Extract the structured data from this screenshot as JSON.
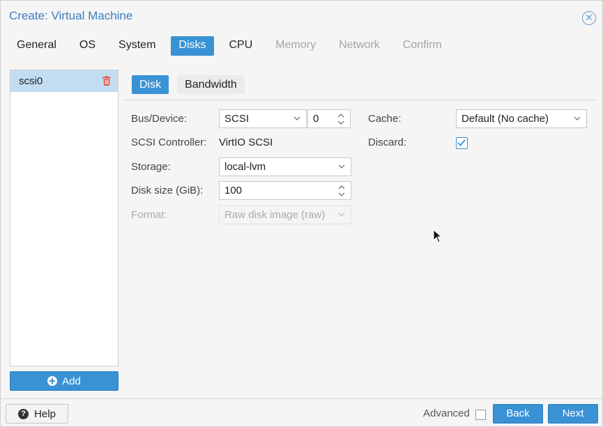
{
  "window": {
    "title": "Create: Virtual Machine"
  },
  "tabs": [
    {
      "label": "General",
      "state": "normal"
    },
    {
      "label": "OS",
      "state": "normal"
    },
    {
      "label": "System",
      "state": "normal"
    },
    {
      "label": "Disks",
      "state": "active"
    },
    {
      "label": "CPU",
      "state": "normal"
    },
    {
      "label": "Memory",
      "state": "disabled"
    },
    {
      "label": "Network",
      "state": "disabled"
    },
    {
      "label": "Confirm",
      "state": "disabled"
    }
  ],
  "disks": {
    "items": [
      {
        "label": "scsi0"
      }
    ],
    "add_label": "Add"
  },
  "subtabs": [
    {
      "label": "Disk"
    },
    {
      "label": "Bandwidth"
    }
  ],
  "form": {
    "bus_device_label": "Bus/Device:",
    "bus_value": "SCSI",
    "device_value": "0",
    "scsi_controller_label": "SCSI Controller:",
    "scsi_controller_value": "VirtIO SCSI",
    "storage_label": "Storage:",
    "storage_value": "local-lvm",
    "disk_size_label": "Disk size (GiB):",
    "disk_size_value": "100",
    "format_label": "Format:",
    "format_value": "Raw disk image (raw)",
    "cache_label": "Cache:",
    "cache_value": "Default (No cache)",
    "discard_label": "Discard:",
    "discard_checked": true
  },
  "footer": {
    "help_label": "Help",
    "advanced_label": "Advanced",
    "advanced_checked": false,
    "back_label": "Back",
    "next_label": "Next"
  },
  "colors": {
    "accent": "#3892d4",
    "selected_row": "#c2ddf2",
    "title": "#3a7fc1",
    "trash": "#e05a4f"
  }
}
